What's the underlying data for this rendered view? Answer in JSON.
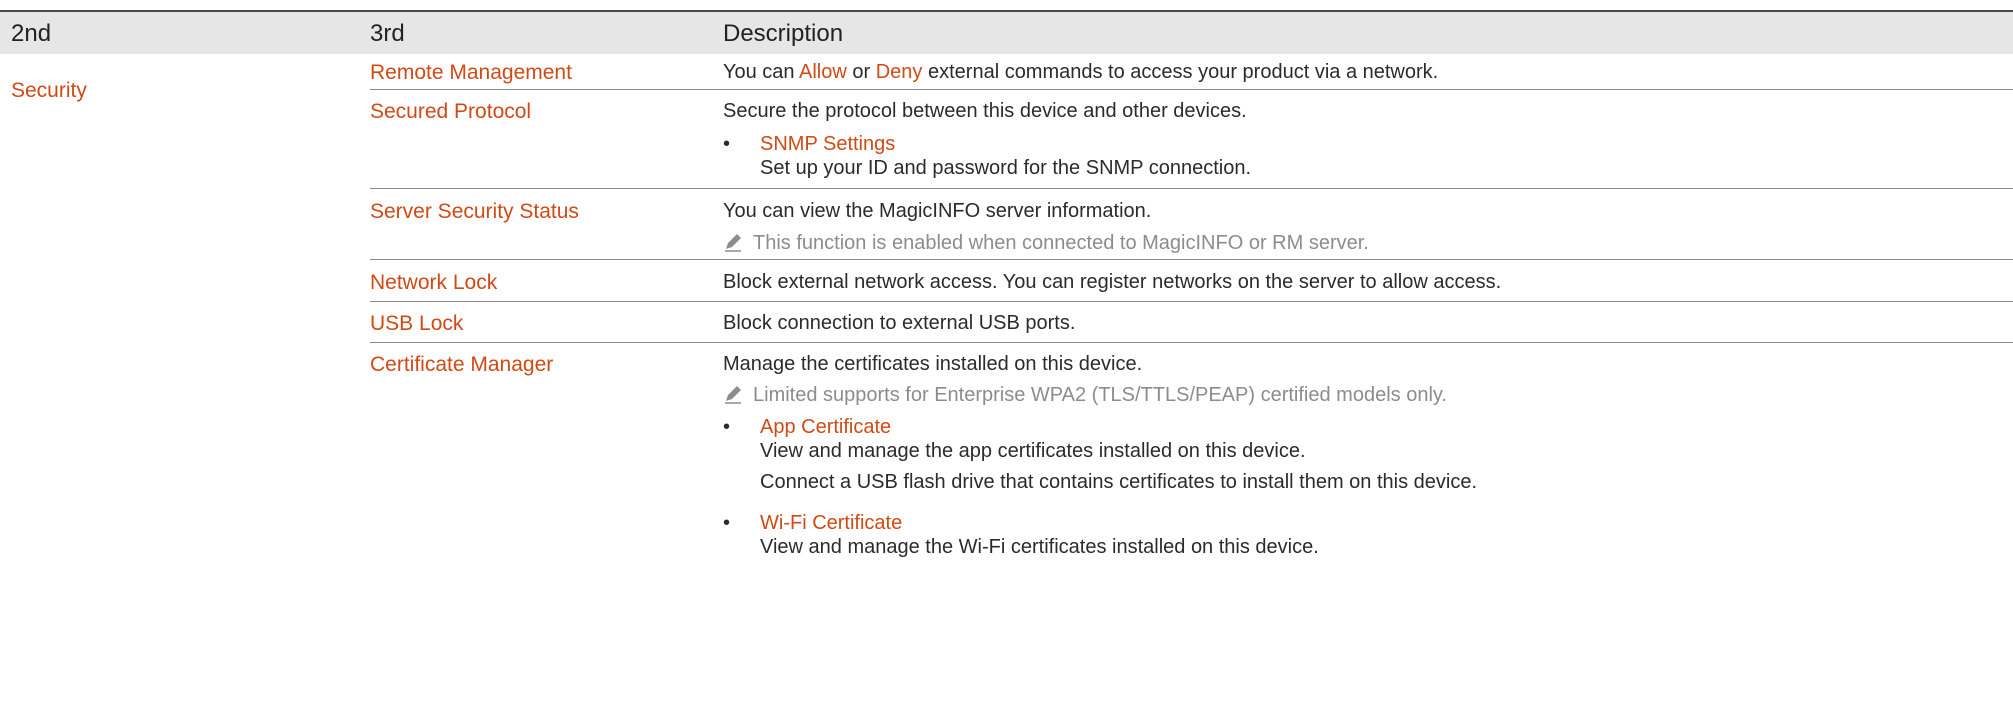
{
  "header": {
    "col_2nd": "2nd",
    "col_3rd": "3rd",
    "col_desc": "Description"
  },
  "second_level": "Security",
  "rows": [
    {
      "third": "Remote Management",
      "desc_pre": "You can ",
      "allow": "Allow",
      "desc_mid": " or ",
      "deny": "Deny",
      "desc_post": " external commands to access your product via a network."
    },
    {
      "third": "Secured Protocol",
      "desc": "Secure the protocol between this device and other devices.",
      "bullet_title": "SNMP Settings",
      "bullet_text": "Set up your ID and password for the SNMP connection."
    },
    {
      "third": "Server Security Status",
      "desc": "You can view the MagicINFO server information.",
      "note": "This function is enabled when connected to MagicINFO or RM server."
    },
    {
      "third": "Network Lock",
      "desc": "Block external network access. You can register networks on the server to allow access."
    },
    {
      "third": "USB Lock",
      "desc": "Block connection to external USB ports."
    },
    {
      "third": "Certificate Manager",
      "desc": "Manage the certificates installed on this device.",
      "note": "Limited supports for Enterprise WPA2 (TLS/TTLS/PEAP) certified models only.",
      "bullet1_title": "App Certificate",
      "bullet1_text1": "View and manage the app certificates installed on this device.",
      "bullet1_text2": "Connect a USB flash drive that contains certificates to install them on this device.",
      "bullet2_title": "Wi-Fi Certificate",
      "bullet2_text": "View and manage the Wi-Fi certificates installed on this device."
    }
  ],
  "bullet_glyph": "•",
  "colors": {
    "accent": "#d14a16",
    "note": "#8c8c8c",
    "header_bg": "#e6e6e6"
  }
}
